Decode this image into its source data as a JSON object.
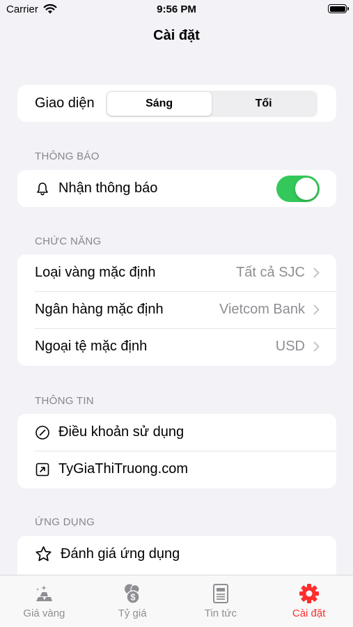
{
  "status_bar": {
    "carrier": "Carrier",
    "time": "9:56 PM"
  },
  "nav": {
    "title": "Cài đặt"
  },
  "appearance": {
    "label": "Giao diện",
    "options": [
      "Sáng",
      "Tối"
    ],
    "selected": "Sáng"
  },
  "notifications": {
    "header": "THÔNG BÁO",
    "items": [
      {
        "label": "Nhận thông báo",
        "icon": "bell-icon",
        "enabled": true
      }
    ]
  },
  "features": {
    "header": "CHỨC NĂNG",
    "items": [
      {
        "label": "Loại vàng mặc định",
        "value": "Tất cả SJC"
      },
      {
        "label": "Ngân hàng mặc định",
        "value": "Vietcom Bank"
      },
      {
        "label": "Ngoại tệ mặc định",
        "value": "USD"
      }
    ]
  },
  "info": {
    "header": "THÔNG TIN",
    "items": [
      {
        "label": "Điều khoản sử dụng",
        "icon": "no-entry-icon"
      },
      {
        "label": "TyGiaThiTruong.com",
        "icon": "external-link-icon"
      }
    ]
  },
  "app": {
    "header": "ỨNG DỤNG",
    "items": [
      {
        "label": "Đánh giá ứng dụng",
        "icon": "star-icon"
      }
    ]
  },
  "tab_bar": {
    "tabs": [
      {
        "label": "Giá vàng",
        "icon": "gold-bars-icon"
      },
      {
        "label": "Tỷ giá",
        "icon": "currency-coins-icon"
      },
      {
        "label": "Tin tức",
        "icon": "newspaper-icon"
      },
      {
        "label": "Cài đặt",
        "icon": "gear-icon",
        "active": true
      }
    ]
  },
  "colors": {
    "accent": "#ff2d2d",
    "toggle_on": "#34c759",
    "background": "#f2f2f7"
  }
}
